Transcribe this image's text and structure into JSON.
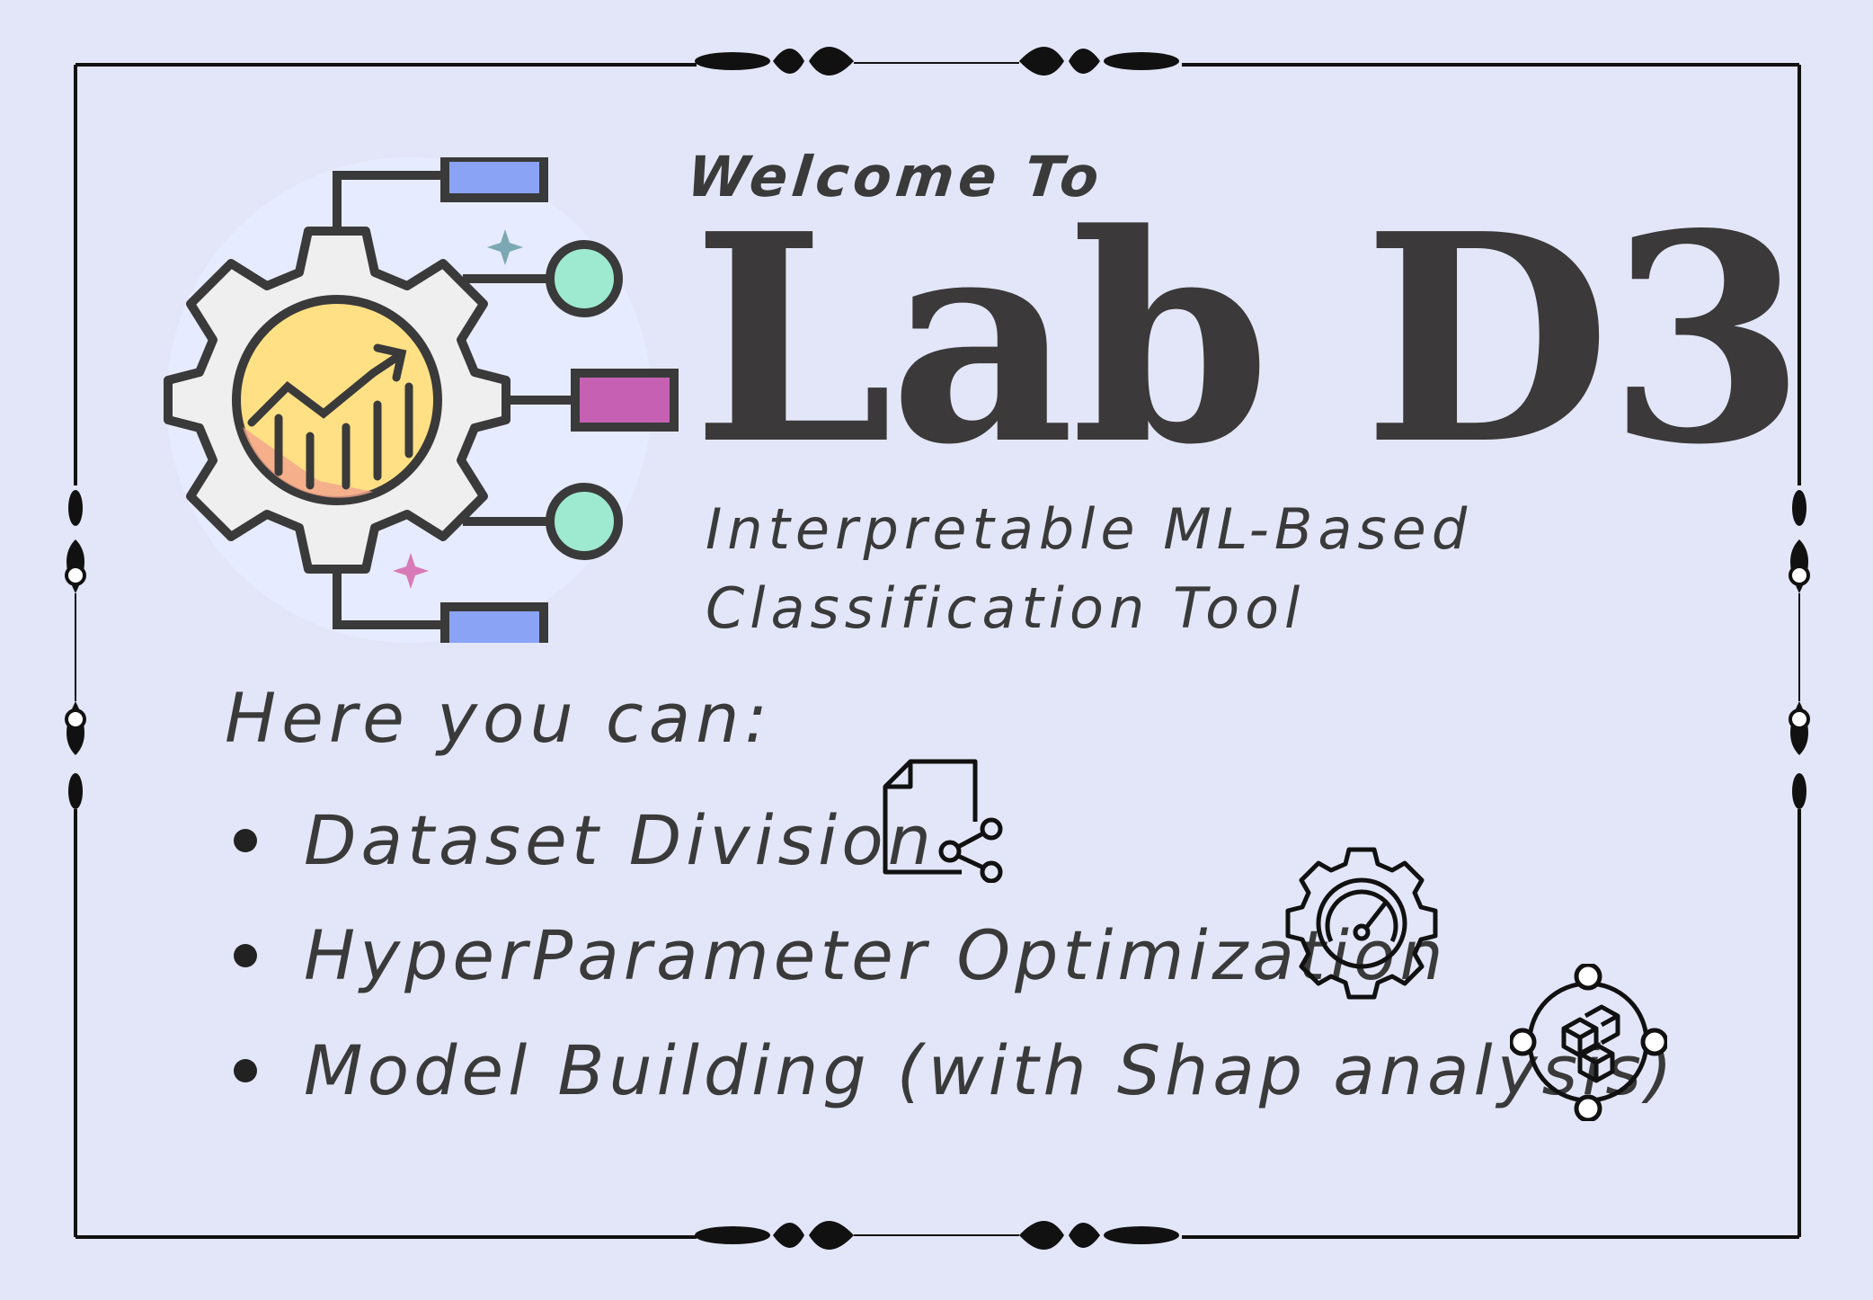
{
  "header": {
    "welcome": "Welcome To",
    "title": "Lab D3",
    "subtitle_line1": "Interpretable ML-Based",
    "subtitle_line2": "Classification Tool"
  },
  "intro": "Here you can:",
  "features": [
    {
      "label": "Dataset Division",
      "icon": "file-share-icon"
    },
    {
      "label": "HyperParameter Optimization",
      "icon": "gear-gauge-icon"
    },
    {
      "label": "Model Building (with Shap analysis)",
      "icon": "cubes-network-icon"
    }
  ],
  "logo": {
    "icon": "gear-analytics-icon"
  },
  "colors": {
    "background": "#e3e6f8",
    "text": "#3a3a3a",
    "frame": "#111111",
    "gear": "#efefef",
    "gear_center": "#ffe084",
    "teal": "#9eead0",
    "magenta": "#c660b3",
    "blue": "#8aa3f5"
  }
}
